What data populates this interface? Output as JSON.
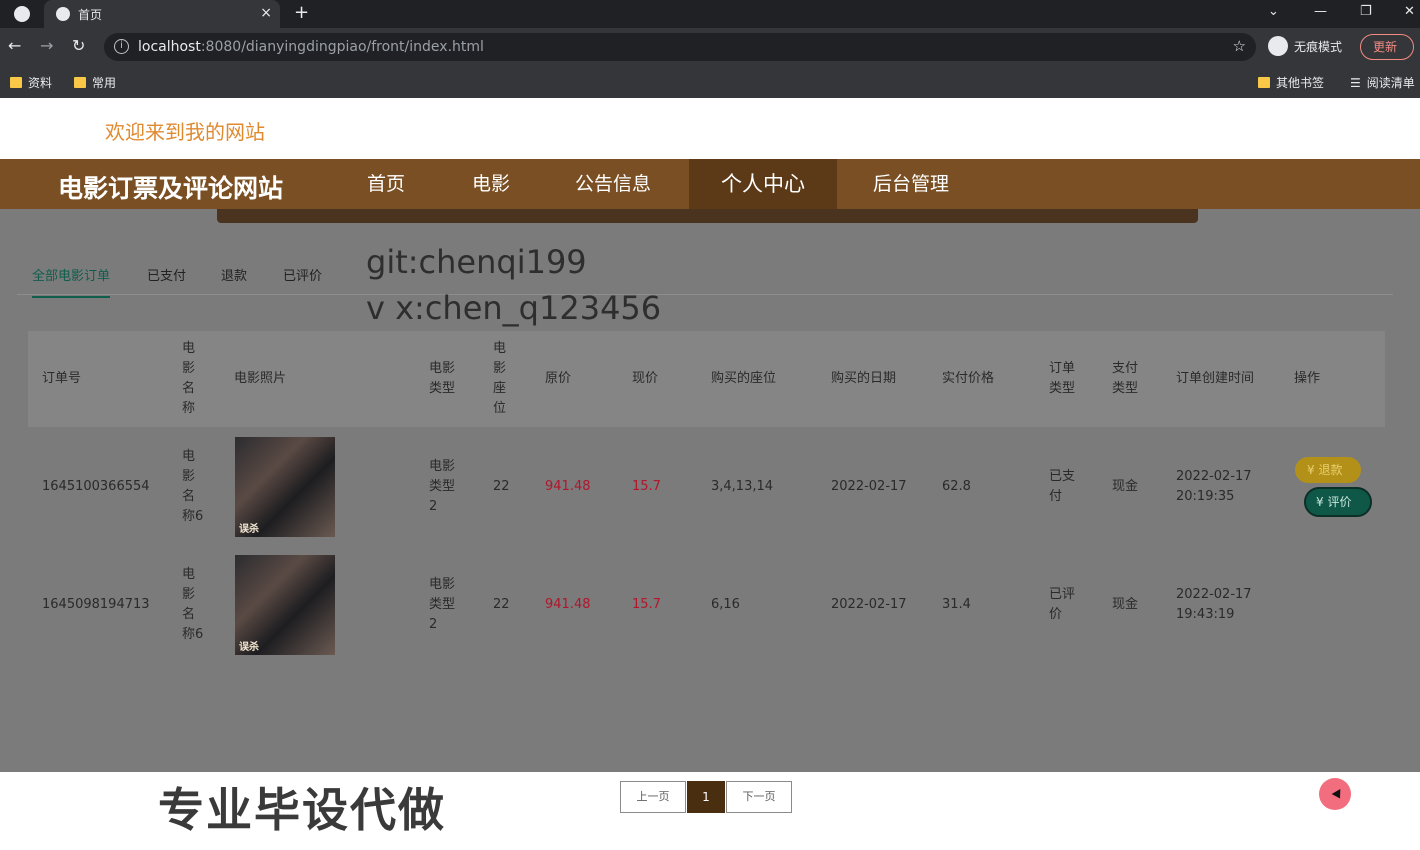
{
  "browser": {
    "tab_title": "首页",
    "new_tab": "+",
    "close": "×",
    "url_host": "localhost",
    "url_path": ":8080/dianyingdingpiao/front/index.html",
    "incognito_label": "无痕模式",
    "update_label": "更新",
    "bookmarks": [
      "资料",
      "常用"
    ],
    "bookmarks_right": [
      "其他书签",
      "阅读清单"
    ]
  },
  "site": {
    "welcome": "欢迎来到我的网站",
    "brand": "电影订票及评论网站",
    "nav": [
      "首页",
      "电影",
      "公告信息",
      "个人中心",
      "后台管理"
    ],
    "nav_active": "个人中心"
  },
  "orders": {
    "tabs": [
      "全部电影订单",
      "已支付",
      "退款",
      "已评价"
    ],
    "active_tab": "全部电影订单",
    "overlay_line1": "git:chenqi199",
    "overlay_line2": "v x:chen_q123456",
    "headers": [
      "订单号",
      "电\n影\n名\n称",
      "电影照片",
      "电影\n类型",
      "电\n影\n座\n位",
      "原价",
      "现价",
      "购买的座位",
      "购买的日期",
      "实付价格",
      "订单\n类型",
      "支付\n类型",
      "订单创建时间",
      "操作"
    ],
    "rows": [
      {
        "order_no": "1645100366554",
        "movie_name": "电\n影\n名\n称6",
        "poster_text": "误杀",
        "movie_type": "电影\n类型\n2",
        "seat_no": "22",
        "original_price": "941.48",
        "current_price": "15.7",
        "seats": "3,4,13,14",
        "date": "2022-02-17",
        "paid": "62.8",
        "order_type": "已支\n付",
        "pay_type": "现金",
        "created": "2022-02-17\n20:19:35",
        "actions": [
          "退款",
          "评价"
        ]
      },
      {
        "order_no": "1645098194713",
        "movie_name": "电\n影\n名\n称6",
        "poster_text": "误杀",
        "movie_type": "电影\n类型\n2",
        "seat_no": "22",
        "original_price": "941.48",
        "current_price": "15.7",
        "seats": "6,16",
        "date": "2022-02-17",
        "paid": "31.4",
        "order_type": "已评\n价",
        "pay_type": "现金",
        "created": "2022-02-17\n19:43:19",
        "actions": []
      }
    ],
    "pager": {
      "prev": "上一页",
      "current": "1",
      "next": "下一页"
    }
  },
  "footer_overlay": "专业毕设代做",
  "colors": {
    "brand_bar": "#7a4f23",
    "welcome": "#e08a30",
    "accent_green": "#0f5e4c",
    "price_red": "#b0172c"
  }
}
